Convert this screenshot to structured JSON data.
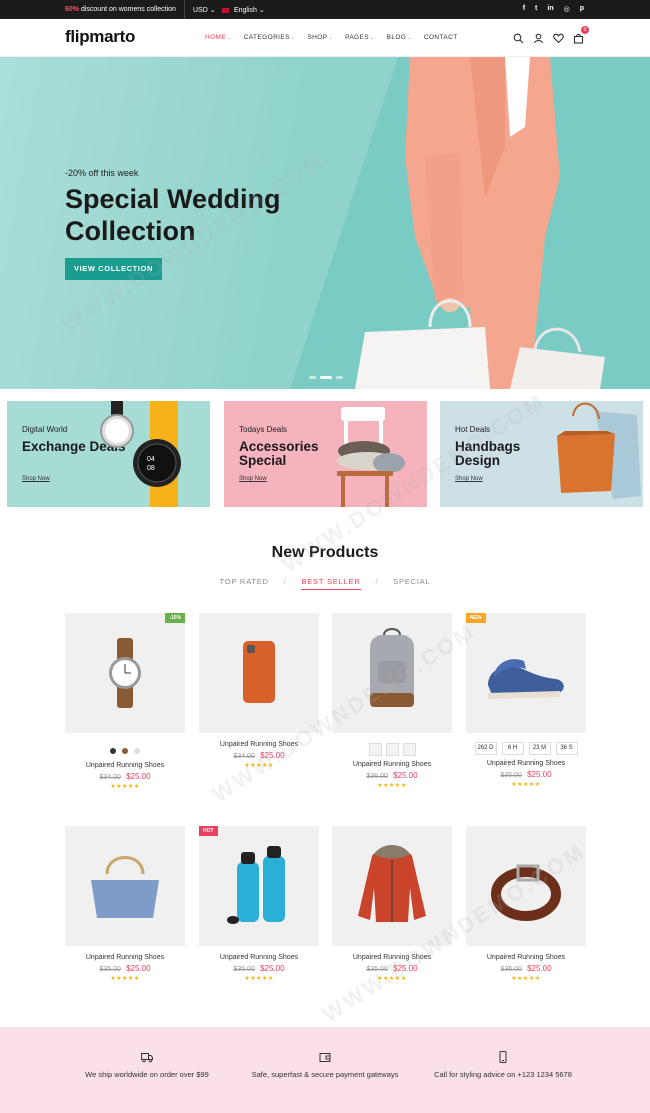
{
  "topbar": {
    "promo_pct": "60%",
    "promo_text": "discount on womens collection",
    "currency": "USD",
    "language": "English",
    "social_icons": [
      "facebook-icon",
      "twitter-icon",
      "linkedin-icon",
      "instagram-icon",
      "pinterest-icon"
    ]
  },
  "header": {
    "logo": "flipmarto",
    "nav": [
      "HOME",
      "CATEGORIES",
      "SHOP",
      "PAGES",
      "BLOG",
      "CONTACT"
    ],
    "cart_count": "0"
  },
  "hero": {
    "tag": "-20% off this week",
    "title": "Special Wedding Collection",
    "button": "VIEW COLLECTION"
  },
  "banners": [
    {
      "small": "Digital World",
      "big": "Exchange Deals",
      "link": "Shop Now"
    },
    {
      "small": "Todays Deals",
      "big": "Accessories Special",
      "link": "Shop Now"
    },
    {
      "small": "Hot Deals",
      "big": "Handbags Design",
      "link": "Shop Now"
    }
  ],
  "products_section": {
    "title": "New Products",
    "tabs": [
      "TOP RATED",
      "BEST SELLER",
      "SPECIAL"
    ],
    "active_tab": "BEST SELLER"
  },
  "products": [
    {
      "name": "Unpaired Running Shoes",
      "old_price": "$34.00",
      "price": "$25.00",
      "label": "-15%"
    },
    {
      "name": "Unpaired Running Shoes",
      "old_price": "$34.00",
      "price": "$25.00",
      "label": ""
    },
    {
      "name": "Unpaired Running Shoes",
      "old_price": "$36.00",
      "price": "$25.00",
      "label": ""
    },
    {
      "name": "Unpaired Running Shoes",
      "old_price": "$35.00",
      "price": "$25.00",
      "label": "NEW"
    },
    {
      "name": "Unpaired Running Shoes",
      "old_price": "$35.00",
      "price": "$25.00",
      "label": ""
    },
    {
      "name": "Unpaired Running Shoes",
      "old_price": "$35.00",
      "price": "$25.00",
      "label": "HOT"
    },
    {
      "name": "Unpaired Running Shoes",
      "old_price": "$35.00",
      "price": "$25.00",
      "label": ""
    },
    {
      "name": "Unpaired Running Shoes",
      "old_price": "$36.00",
      "price": "$25.00",
      "label": ""
    }
  ],
  "countdown": [
    "262 D",
    "6 H",
    "23 M",
    "36 S"
  ],
  "rating_stars": "★★★★★",
  "features": [
    {
      "icon": "truck-icon",
      "text": "We ship worldwide on order over $99"
    },
    {
      "icon": "wallet-icon",
      "text": "Safe, superfast & secure payment gateways"
    },
    {
      "icon": "phone-icon",
      "text": "Call for styling advice on +123 1234 5678"
    }
  ],
  "watermark": "WWW.DOWNDEMO.COM",
  "colors": {
    "accent": "#e8415f",
    "teal": "#1a9c8f",
    "hero_bg": "#8fd3cb",
    "star": "#f5b301"
  }
}
